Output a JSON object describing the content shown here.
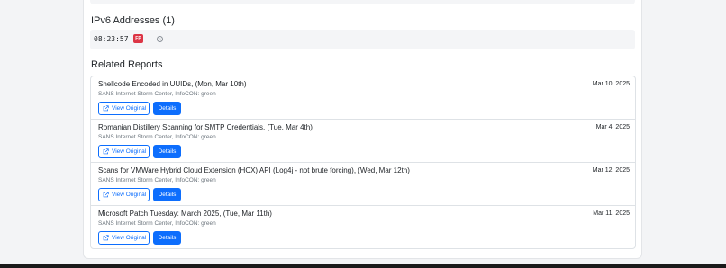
{
  "ipv6": {
    "title": "IPv6 Addresses (1)",
    "value": "08:23:57",
    "badge": "FP",
    "help": "?"
  },
  "related": {
    "title": "Related Reports",
    "view_label": "View Original",
    "details_label": "Details",
    "reports": [
      {
        "title": "Shellcode Encoded in UUIDs, (Mon, Mar 10th)",
        "date": "Mar 10, 2025",
        "source": "SANS Internet Storm Center, InfoCON: green"
      },
      {
        "title": "Romanian Distillery Scanning for SMTP Credentials, (Tue, Mar 4th)",
        "date": "Mar 4, 2025",
        "source": "SANS Internet Storm Center, InfoCON: green"
      },
      {
        "title": "Scans for VMWare Hybrid Cloud Extension (HCX) API (Log4j - not brute forcing), (Wed, Mar 12th)",
        "date": "Mar 12, 2025",
        "source": "SANS Internet Storm Center, InfoCON: green"
      },
      {
        "title": "Microsoft Patch Tuesday: March 2025, (Tue, Mar 11th)",
        "date": "Mar 11, 2025",
        "source": "SANS Internet Storm Center, InfoCON: green"
      }
    ]
  },
  "colors": {
    "primary": "#0d6efd",
    "badge": "#dc3545",
    "muted": "#6c757d"
  }
}
